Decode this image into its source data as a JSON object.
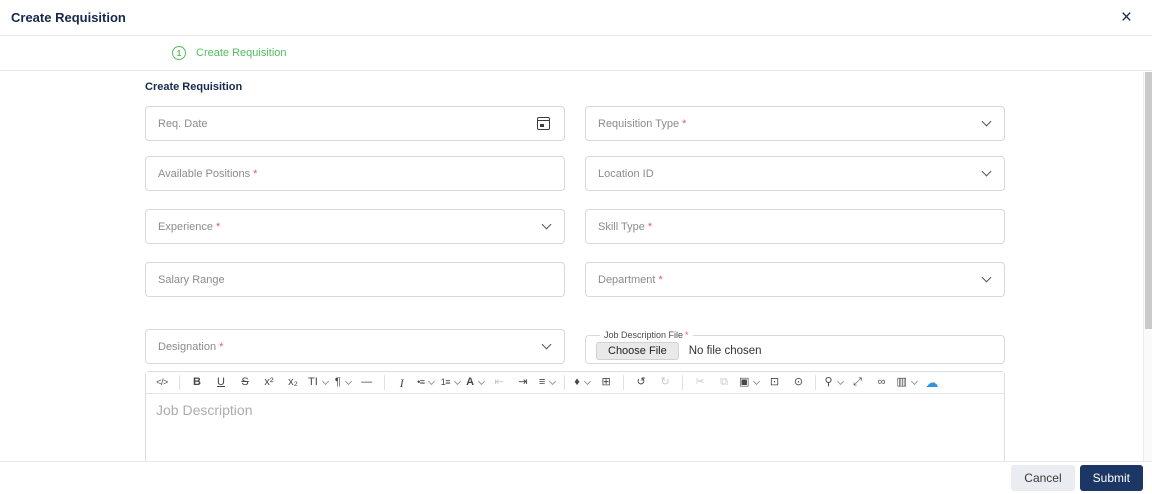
{
  "modal": {
    "title": "Create Requisition",
    "close_icon": "×"
  },
  "stepper": {
    "step_number": "1",
    "step_label": "Create Requisition"
  },
  "form": {
    "section_title": "Create Requisition",
    "required_marker": "*",
    "fields": {
      "req_date": {
        "placeholder": "Req. Date"
      },
      "requisition_type": {
        "placeholder": "Requisition Type"
      },
      "available_positions": {
        "placeholder": "Available Positions"
      },
      "location_id": {
        "placeholder": "Location ID"
      },
      "experience": {
        "placeholder": "Experience"
      },
      "skill_type": {
        "placeholder": "Skill Type"
      },
      "salary_range": {
        "placeholder": "Salary Range"
      },
      "department": {
        "placeholder": "Department"
      },
      "designation": {
        "placeholder": "Designation"
      },
      "job_description_file": {
        "label": "Job Description File",
        "button_label": "Choose File",
        "status_text": "No file chosen"
      }
    }
  },
  "editor": {
    "placeholder": "Job Description",
    "toolbar": [
      {
        "name": "code-view",
        "glyph": "</>"
      },
      {
        "name": "bold",
        "glyph": "B"
      },
      {
        "name": "underline",
        "glyph": "U"
      },
      {
        "name": "strikethrough",
        "glyph": "S"
      },
      {
        "name": "superscript",
        "glyph": "x²"
      },
      {
        "name": "subscript",
        "glyph": "x₂"
      },
      {
        "name": "font-size",
        "glyph": "TI"
      },
      {
        "name": "paragraph-format",
        "glyph": "¶"
      },
      {
        "name": "horizontal-line",
        "glyph": "—"
      },
      {
        "name": "italic",
        "glyph": "I"
      },
      {
        "name": "unordered-list",
        "glyph": "•≡"
      },
      {
        "name": "ordered-list",
        "glyph": "1≡"
      },
      {
        "name": "text-color",
        "glyph": "A"
      },
      {
        "name": "outdent",
        "glyph": "⇤"
      },
      {
        "name": "indent",
        "glyph": "⇥"
      },
      {
        "name": "align",
        "glyph": "≡"
      },
      {
        "name": "colors",
        "glyph": "♦"
      },
      {
        "name": "insert-table",
        "glyph": "⊞"
      },
      {
        "name": "undo",
        "glyph": "↺"
      },
      {
        "name": "redo",
        "glyph": "↻"
      },
      {
        "name": "cut",
        "glyph": "✂"
      },
      {
        "name": "copy",
        "glyph": "⧉"
      },
      {
        "name": "paste",
        "glyph": "▣"
      },
      {
        "name": "select-all",
        "glyph": "⊡"
      },
      {
        "name": "preview",
        "glyph": "⊙"
      },
      {
        "name": "zoom",
        "glyph": "⚲"
      },
      {
        "name": "fullscreen",
        "glyph": "⤢"
      },
      {
        "name": "insert-link",
        "glyph": "∞"
      },
      {
        "name": "insert-image",
        "glyph": "▥"
      },
      {
        "name": "cloud-upload",
        "glyph": "☁"
      }
    ]
  },
  "footer": {
    "cancel_label": "Cancel",
    "submit_label": "Submit"
  },
  "colors": {
    "stepper_green": "#52bc5e",
    "title_navy": "#16294d",
    "submit_bg": "#1c3765",
    "required_red": "#e05e5e",
    "upload_blue": "#2a95e5",
    "field_border": "#d8d8d8"
  }
}
